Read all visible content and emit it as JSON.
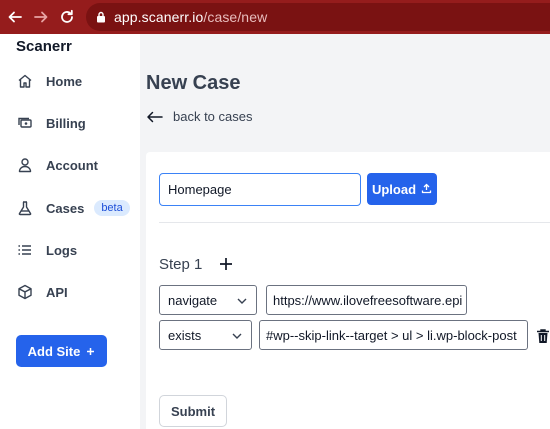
{
  "browser": {
    "url_host": "app.scanerr.io",
    "url_path": "/case/new",
    "back_icon": "arrow-left-icon",
    "forward_icon": "arrow-right-icon",
    "reload_icon": "reload-icon",
    "lock_icon": "lock-icon",
    "bar_color": "#951c1c"
  },
  "sidebar": {
    "brand": "Scanerr",
    "items": [
      {
        "label": "Home",
        "icon": "home-icon"
      },
      {
        "label": "Billing",
        "icon": "billing-icon"
      },
      {
        "label": "Account",
        "icon": "user-icon"
      },
      {
        "label": "Cases",
        "icon": "flask-icon",
        "badge": "beta"
      },
      {
        "label": "Logs",
        "icon": "list-icon"
      },
      {
        "label": "API",
        "icon": "cube-icon"
      }
    ],
    "add_site_label": "Add Site",
    "add_site_icon": "plus-icon"
  },
  "main": {
    "title": "New Case",
    "back_label": "back to cases",
    "case_name_value": "Homepage",
    "upload_label": "Upload",
    "upload_icon": "upload-icon",
    "step_label": "Step 1",
    "step_add_icon": "plus-icon",
    "steps": [
      {
        "action": "navigate",
        "value": "https://www.ilovefreesoftware.epi"
      },
      {
        "action": "exists",
        "value": "#wp--skip-link--target > ul > li.wp-block-post"
      }
    ],
    "delete_icon": "trash-icon",
    "submit_label": "Submit"
  },
  "colors": {
    "accent": "#2563eb",
    "badge_bg": "#dbeafe",
    "badge_text": "#1d4ed8"
  }
}
